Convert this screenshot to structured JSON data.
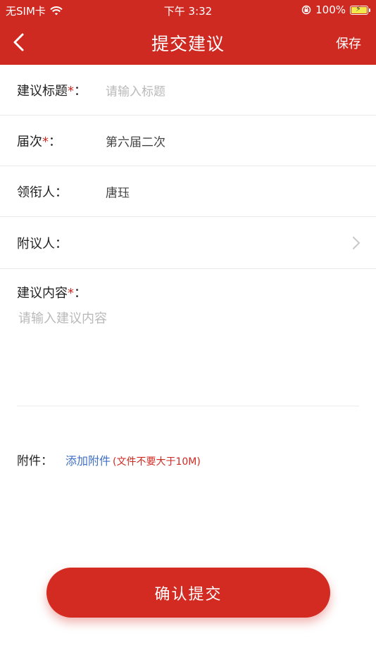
{
  "status_bar": {
    "carrier": "无SIM卡",
    "time": "下午 3:32",
    "battery": "100%"
  },
  "nav": {
    "title": "提交建议",
    "save_label": "保存"
  },
  "form": {
    "title_label": "建议标题",
    "title_placeholder": "请输入标题",
    "session_label": "届次",
    "session_value": "第六届二次",
    "leader_label": "领衔人：",
    "leader_value": "唐珏",
    "cosigner_label": "附议人：",
    "content_label": "建议内容",
    "content_placeholder": "请输入建议内容",
    "attachment_label": "附件：",
    "attachment_link": "添加附件",
    "attachment_note": "(文件不要大于10M)",
    "required_mark": "*",
    "colon": "："
  },
  "submit_label": "确认提交",
  "colors": {
    "primary": "#cf2a22",
    "link": "#3f6fc4",
    "placeholder": "#b9b9b9"
  }
}
